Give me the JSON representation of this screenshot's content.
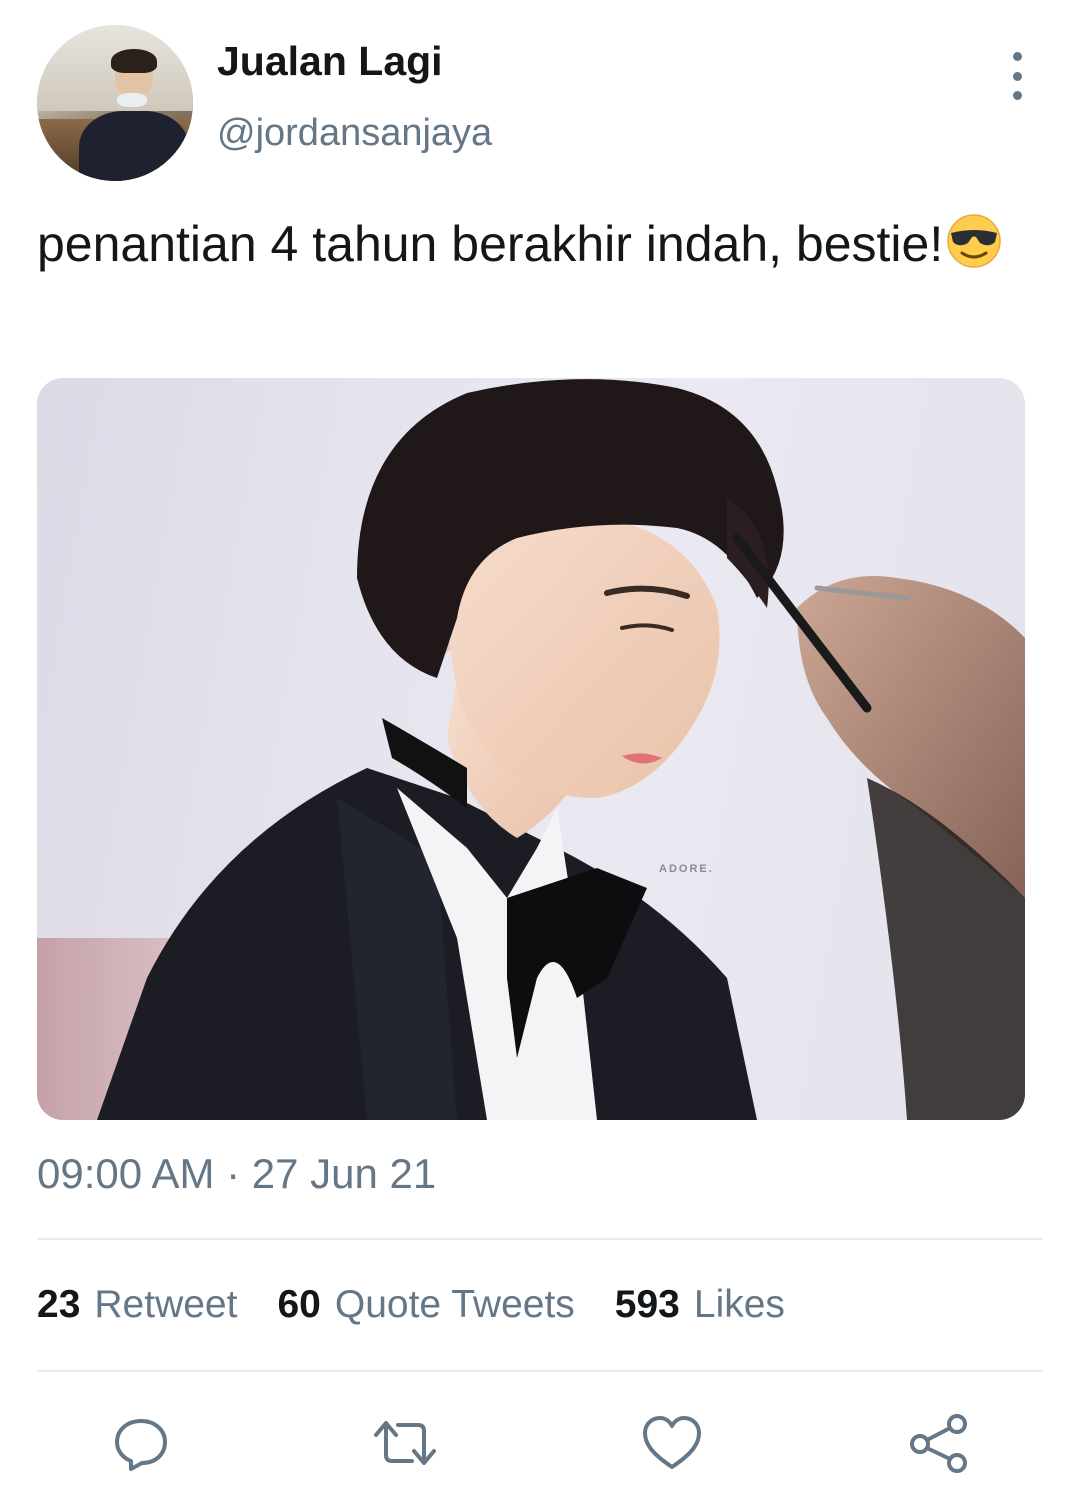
{
  "tweet": {
    "display_name": "Jualan Lagi",
    "handle": "@jordansanjaya",
    "text": "penantian 4 tahun berakhir indah, bestie!",
    "emoji": "smiling-face-with-sunglasses",
    "media_watermark": "ADORE.",
    "timestamp": "09:00 AM · 27 Jun 21"
  },
  "stats": [
    {
      "count": "23",
      "label": "Retweet"
    },
    {
      "count": "60",
      "label": "Quote Tweets"
    },
    {
      "count": "593",
      "label": "Likes"
    }
  ],
  "actions": [
    "reply-icon",
    "retweet-icon",
    "like-icon",
    "share-icon"
  ],
  "colors": {
    "text_primary": "#14171a",
    "text_secondary": "#657786",
    "divider": "#e6ecf0",
    "icon": "#657786"
  }
}
